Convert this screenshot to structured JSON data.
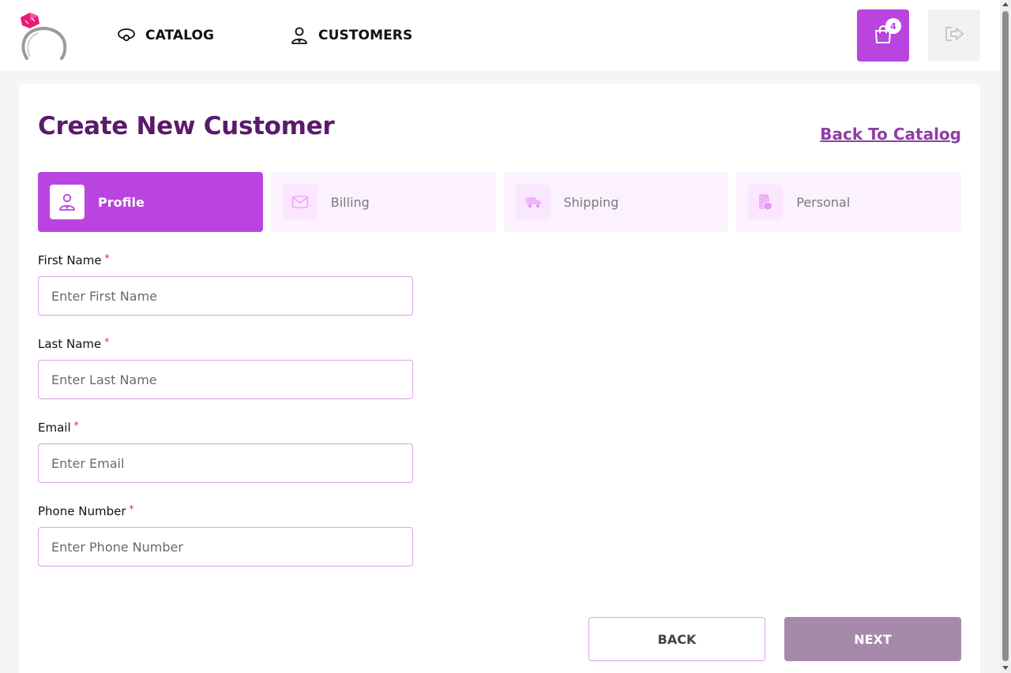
{
  "brand": {
    "logo_icon": "ring-logo-icon",
    "accent_color": "#b944df",
    "title_color": "#5a1a6b"
  },
  "nav": {
    "items": [
      {
        "label": "CATALOG",
        "icon": "ring-icon"
      },
      {
        "label": "CUSTOMERS",
        "icon": "user-icon"
      }
    ]
  },
  "header_actions": {
    "cart_icon": "shopping-bag-icon",
    "cart_count": "4",
    "logout_icon": "logout-icon"
  },
  "page": {
    "title": "Create New Customer",
    "back_link": "Back To Catalog"
  },
  "steps": [
    {
      "label": "Profile",
      "icon": "profile-icon",
      "active": true
    },
    {
      "label": "Billing",
      "icon": "envelope-icon",
      "active": false
    },
    {
      "label": "Shipping",
      "icon": "truck-icon",
      "active": false
    },
    {
      "label": "Personal",
      "icon": "document-shield-icon",
      "active": false
    }
  ],
  "form": {
    "required_mark": "*",
    "fields": [
      {
        "label": "First Name",
        "placeholder": "Enter First Name",
        "value": ""
      },
      {
        "label": "Last Name",
        "placeholder": "Enter Last Name",
        "value": ""
      },
      {
        "label": "Email",
        "placeholder": "Enter Email",
        "value": ""
      },
      {
        "label": "Phone Number",
        "placeholder": "Enter Phone Number",
        "value": ""
      }
    ]
  },
  "actions": {
    "back_label": "BACK",
    "next_label": "NEXT"
  }
}
